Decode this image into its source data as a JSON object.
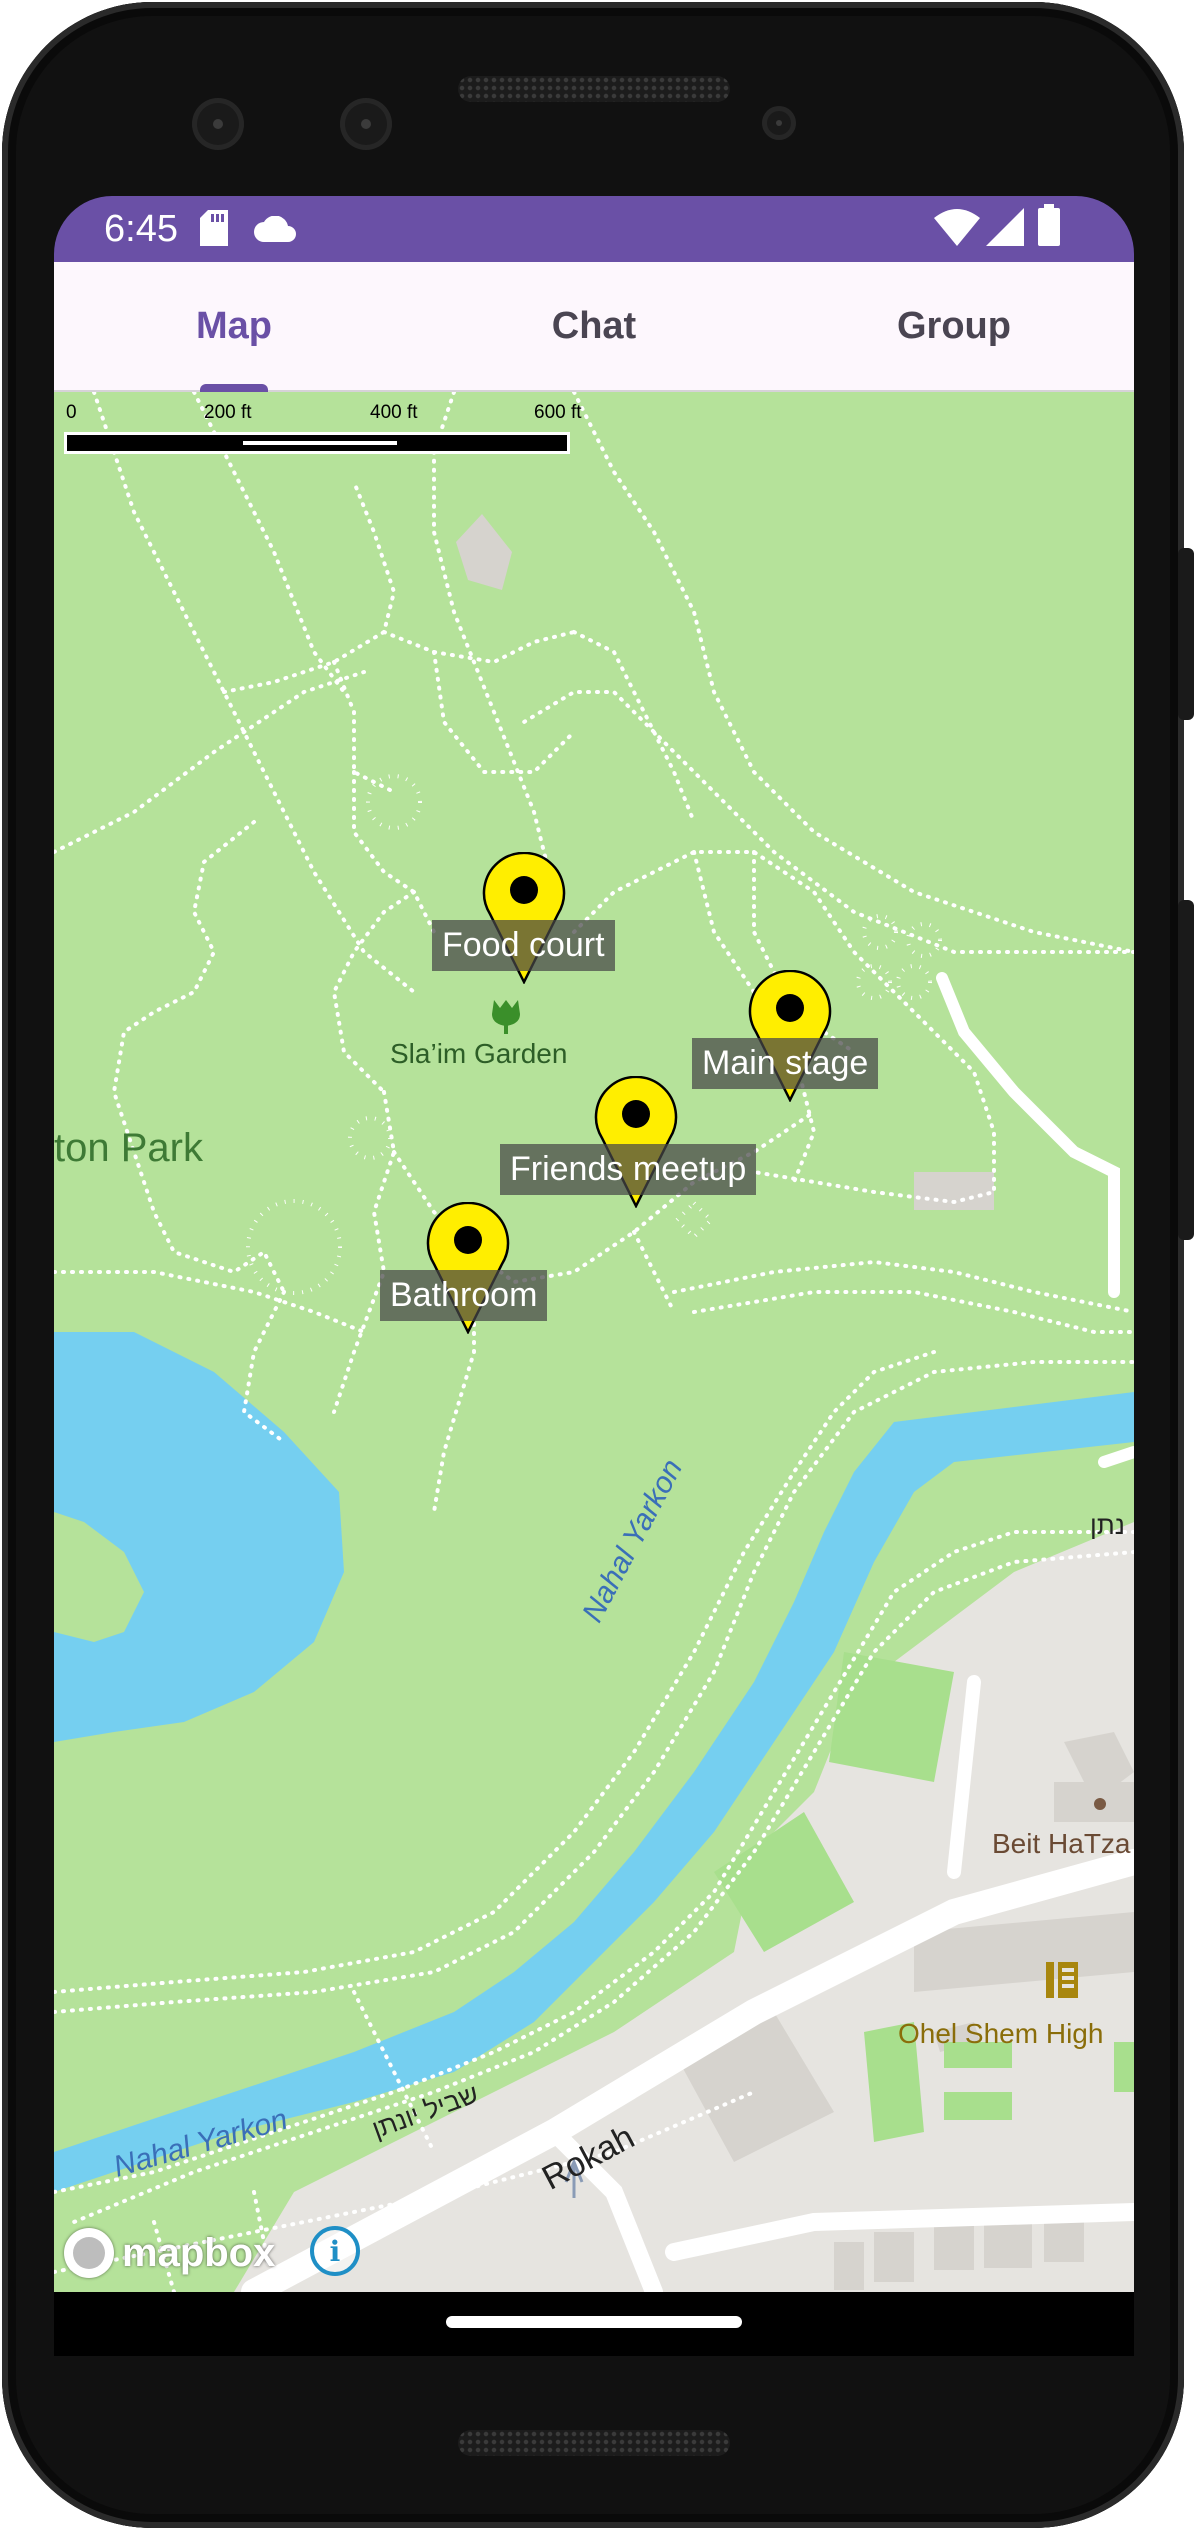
{
  "status_bar": {
    "time": "6:45",
    "color": "#6a50a6",
    "left_icons": [
      "sd-card-icon",
      "cloud-icon"
    ],
    "right_icons": [
      "wifi-icon",
      "signal-icon",
      "battery-icon"
    ]
  },
  "tabs": [
    {
      "label": "Map",
      "selected": true
    },
    {
      "label": "Chat",
      "selected": false
    },
    {
      "label": "Group",
      "selected": false
    }
  ],
  "map": {
    "scale_bar": {
      "labels": [
        "0",
        "200 ft",
        "400 ft",
        "600 ft"
      ]
    },
    "place_labels": {
      "garden": "Sla’im Garden",
      "park": "ton Park",
      "river_upper": "Nahal Yarkon",
      "river_lower": "Nahal Yarkon",
      "trail_lower": "שביל יונתן",
      "trail_right": "נתן",
      "beit": "Beit HaTza",
      "school": "Ohel Shem High",
      "street": "Rokah"
    },
    "markers": [
      {
        "label": "Food court"
      },
      {
        "label": "Main stage"
      },
      {
        "label": "Friends meetup"
      },
      {
        "label": "Bathroom"
      }
    ],
    "attribution": {
      "logo_text": "mapbox",
      "info_glyph": "i"
    },
    "colors": {
      "park": "#b5e29a",
      "water": "#75cff0",
      "urban": "#e6e4e0",
      "road": "#ffffff",
      "marker": "#ffee00"
    }
  }
}
